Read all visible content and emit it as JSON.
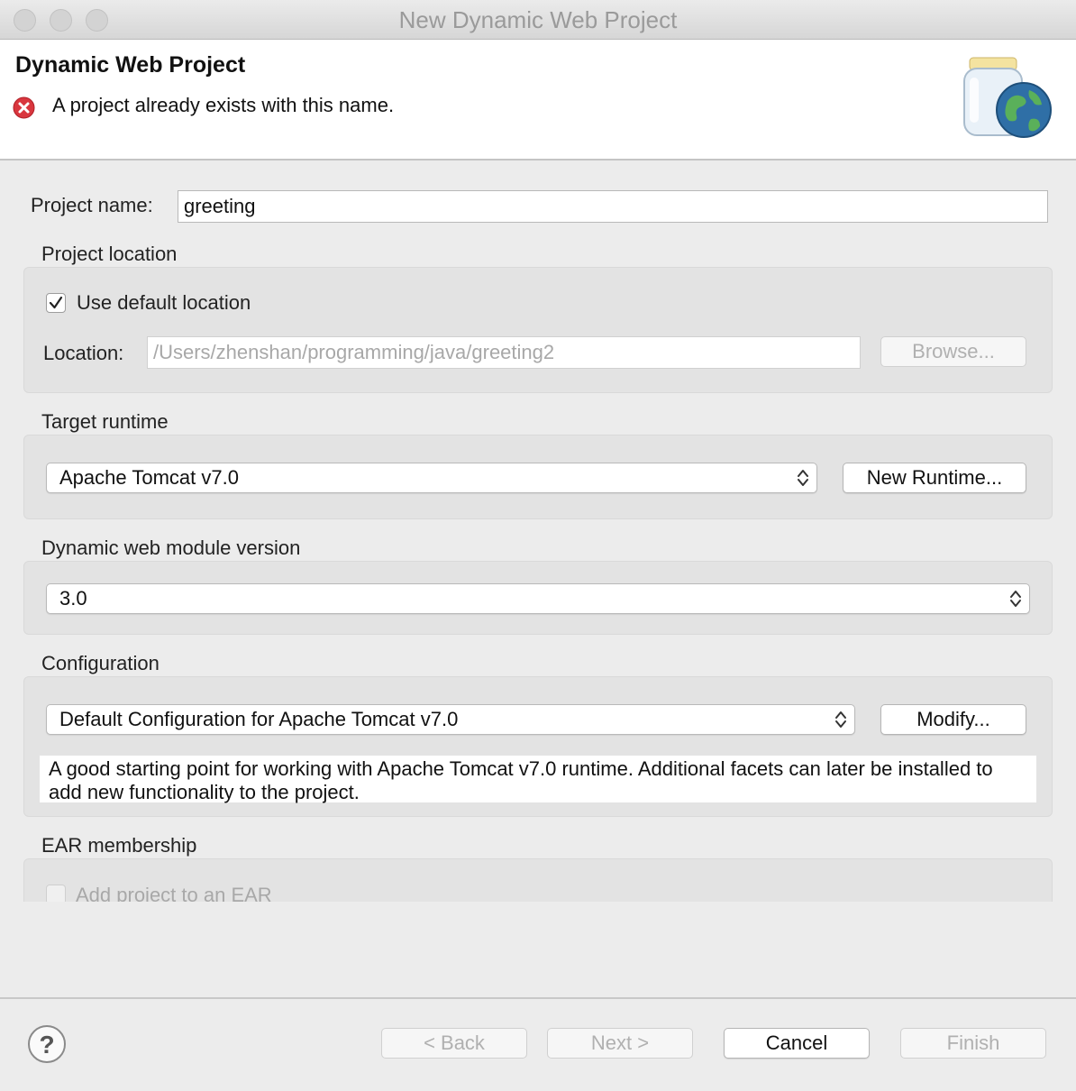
{
  "window": {
    "title": "New Dynamic Web Project"
  },
  "header": {
    "title": "Dynamic Web Project",
    "message": "A project already exists with this name.",
    "message_icon": "error-icon"
  },
  "project_name": {
    "label": "Project name:",
    "value": "greeting"
  },
  "project_location": {
    "section_label": "Project location",
    "use_default_label": "Use default location",
    "use_default_checked": true,
    "location_label": "Location:",
    "location_value": "/Users/zhenshan/programming/java/greeting2",
    "browse_label": "Browse..."
  },
  "target_runtime": {
    "section_label": "Target runtime",
    "selected": "Apache Tomcat v7.0",
    "new_runtime_label": "New Runtime..."
  },
  "module_version": {
    "section_label": "Dynamic web module version",
    "selected": "3.0"
  },
  "configuration": {
    "section_label": "Configuration",
    "selected": "Default Configuration for Apache Tomcat v7.0",
    "modify_label": "Modify...",
    "description": "A good starting point for working with Apache Tomcat v7.0 runtime. Additional facets can later be installed to add new functionality to the project."
  },
  "ear_membership": {
    "section_label": "EAR membership",
    "add_to_ear_label": "Add project to an EAR",
    "add_to_ear_checked": false
  },
  "footer": {
    "help_icon": "help-icon",
    "help_glyph": "?",
    "back_label": "< Back",
    "next_label": "Next >",
    "cancel_label": "Cancel",
    "finish_label": "Finish"
  }
}
